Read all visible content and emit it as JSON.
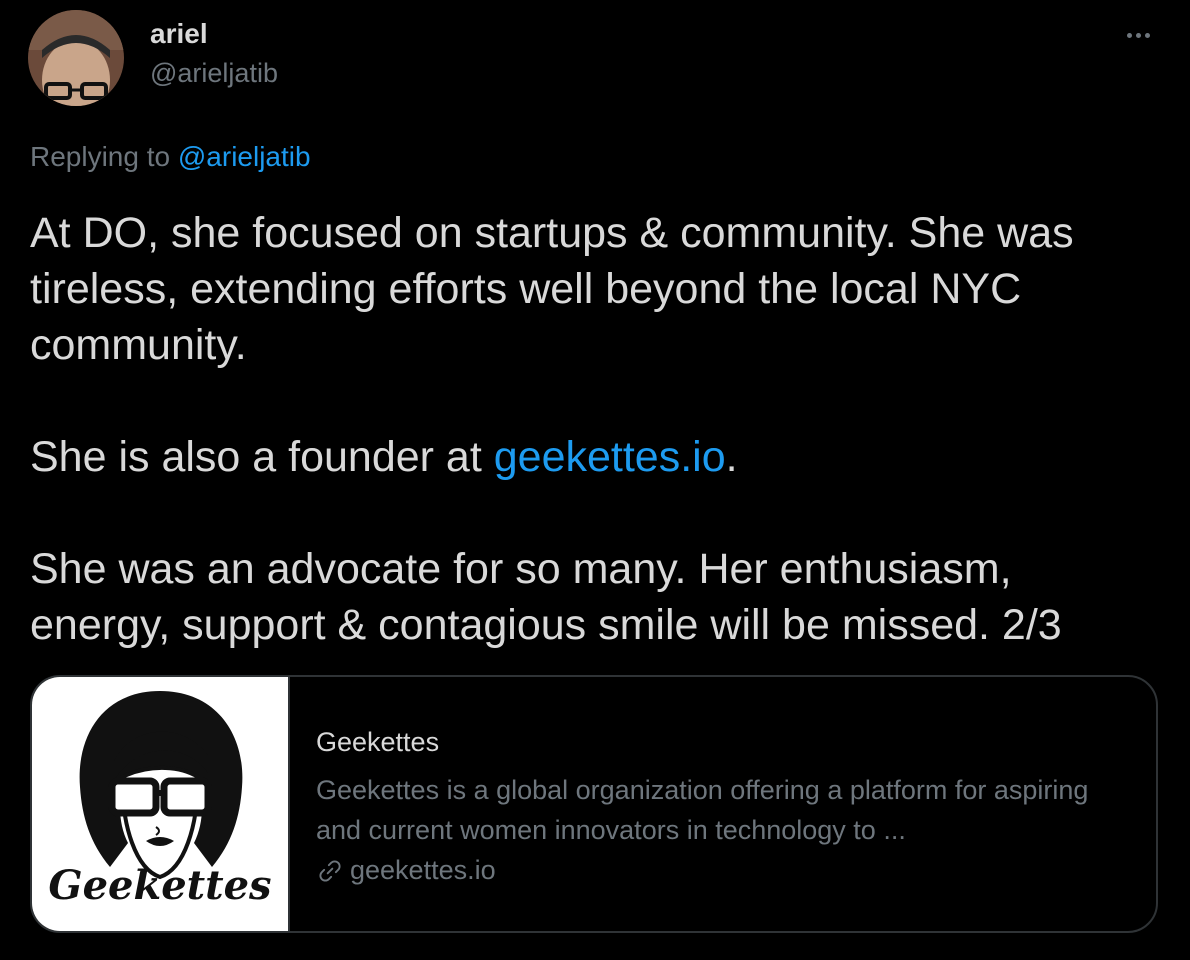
{
  "author": {
    "display_name": "ariel",
    "handle": "@arieljatib"
  },
  "reply_context": {
    "prefix": "Replying to",
    "mention": "@arieljatib"
  },
  "tweet": {
    "paragraph1": "At DO, she focused on startups & community. She was tireless, extending efforts well beyond the local NYC community.",
    "paragraph2_prefix": "She is also a founder at ",
    "paragraph2_link": "geekettes.io",
    "paragraph2_suffix": ".",
    "paragraph3": "She was an advocate for so many. Her enthusiasm, energy, support & contagious smile will be missed. 2/3"
  },
  "link_card": {
    "logo_text": "Geekettes",
    "title": "Geekettes",
    "description": "Geekettes is a global organization offering a platform for aspiring and current women innovators in technology to ...",
    "domain": "geekettes.io"
  },
  "colors": {
    "background": "#000000",
    "text": "#d9d9d9",
    "secondary": "#6e767d",
    "link": "#1d9bf0",
    "border": "#2f3336"
  },
  "icons": {
    "more": "more-horizontal-icon",
    "link": "link-icon"
  }
}
